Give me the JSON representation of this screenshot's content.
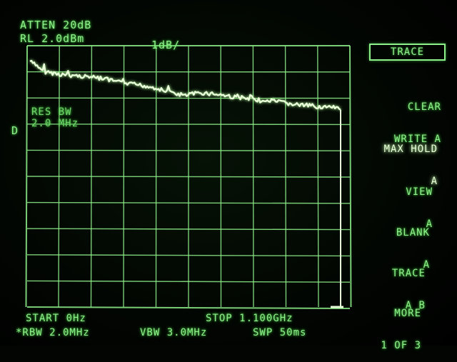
{
  "header": {
    "atten": "ATTEN 20dB",
    "ref_level": "RL 2.0dBm",
    "scale": "1dB/",
    "marker_side": "D"
  },
  "overlay": {
    "rbw_label": "RES BW",
    "rbw_value": "2.0 MHz"
  },
  "softkeys": {
    "title": "TRACE",
    "items": [
      {
        "line1": "CLEAR",
        "line2": "WRITE A"
      },
      {
        "line1": "MAX HOLD",
        "line2": "A"
      },
      {
        "line1": "VIEW",
        "line2": "A"
      },
      {
        "line1": "BLANK",
        "line2": "A"
      },
      {
        "line1": "TRACE",
        "line2": "A B"
      },
      {
        "line1": "MORE",
        "line2": "1 OF 3"
      }
    ]
  },
  "footer": {
    "start": "START 0Hz",
    "stop": "STOP 1.100GHz",
    "rbw": "*RBW 2.0MHz",
    "vbw": "VBW 3.0MHz",
    "swp": "SWP 50ms"
  },
  "colors": {
    "phosphor": "#8ef08a",
    "trace": "#e9ffd9",
    "background": "#020502"
  },
  "chart_data": {
    "type": "line",
    "x_range_hz": [
      0,
      1100000000
    ],
    "y_units": "dB",
    "divisions_x": 10,
    "divisions_y": 10,
    "ref_level_dbm": 2.0,
    "db_per_div": 1,
    "series": [
      {
        "values_dbm": [
          1.4,
          1.0,
          0.9,
          0.85,
          0.8,
          0.7,
          0.55,
          0.5,
          0.4,
          0.2,
          0.1,
          0.2,
          0.15,
          0.05,
          -0.05,
          -0.1,
          -0.15,
          -0.25,
          -0.3,
          -0.35,
          -0.4
        ]
      }
    ]
  }
}
